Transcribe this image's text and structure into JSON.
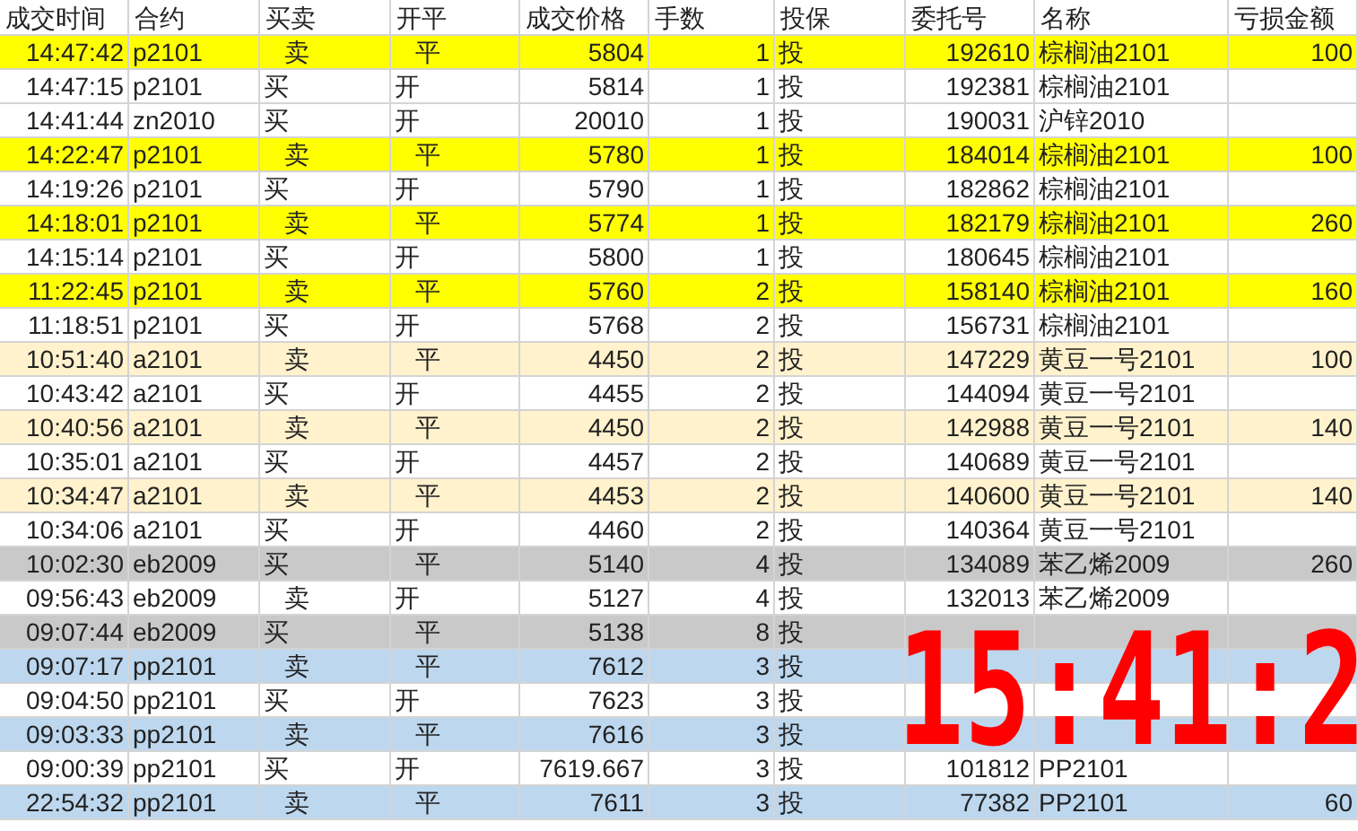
{
  "table": {
    "columns": [
      "成交时间",
      "合约",
      "买卖",
      "开平",
      "成交价格",
      "手数",
      "投保",
      "委托号",
      "名称",
      "亏损金额"
    ],
    "rows": [
      {
        "color": "#ffff00",
        "cells": [
          "14:47:42",
          "p2101",
          "   卖",
          "   平",
          "5804",
          "1",
          "投",
          "192610",
          "棕榈油2101",
          "100"
        ]
      },
      {
        "color": "#ffffff",
        "cells": [
          "14:47:15",
          "p2101",
          "买",
          "开",
          "5814",
          "1",
          "投",
          "192381",
          "棕榈油2101",
          ""
        ]
      },
      {
        "color": "#ffffff",
        "cells": [
          "14:41:44",
          "zn2010",
          "买",
          "开",
          "20010",
          "1",
          "投",
          "190031",
          "沪锌2010",
          ""
        ]
      },
      {
        "color": "#ffff00",
        "cells": [
          "14:22:47",
          "p2101",
          "   卖",
          "   平",
          "5780",
          "1",
          "投",
          "184014",
          "棕榈油2101",
          "100"
        ]
      },
      {
        "color": "#ffffff",
        "cells": [
          "14:19:26",
          "p2101",
          "买",
          "开",
          "5790",
          "1",
          "投",
          "182862",
          "棕榈油2101",
          ""
        ]
      },
      {
        "color": "#ffff00",
        "cells": [
          "14:18:01",
          "p2101",
          "   卖",
          "   平",
          "5774",
          "1",
          "投",
          "182179",
          "棕榈油2101",
          "260"
        ]
      },
      {
        "color": "#ffffff",
        "cells": [
          "14:15:14",
          "p2101",
          "买",
          "开",
          "5800",
          "1",
          "投",
          "180645",
          "棕榈油2101",
          ""
        ]
      },
      {
        "color": "#ffff00",
        "cells": [
          "11:22:45",
          "p2101",
          "   卖",
          "   平",
          "5760",
          "2",
          "投",
          "158140",
          "棕榈油2101",
          "160"
        ]
      },
      {
        "color": "#ffffff",
        "cells": [
          "11:18:51",
          "p2101",
          "买",
          "开",
          "5768",
          "2",
          "投",
          "156731",
          "棕榈油2101",
          ""
        ]
      },
      {
        "color": "#fff2cc",
        "cells": [
          "10:51:40",
          "a2101",
          "   卖",
          "   平",
          "4450",
          "2",
          "投",
          "147229",
          "黄豆一号2101",
          "100"
        ]
      },
      {
        "color": "#ffffff",
        "cells": [
          "10:43:42",
          "a2101",
          "买",
          "开",
          "4455",
          "2",
          "投",
          "144094",
          "黄豆一号2101",
          ""
        ]
      },
      {
        "color": "#fff2cc",
        "cells": [
          "10:40:56",
          "a2101",
          "   卖",
          "   平",
          "4450",
          "2",
          "投",
          "142988",
          "黄豆一号2101",
          "140"
        ]
      },
      {
        "color": "#ffffff",
        "cells": [
          "10:35:01",
          "a2101",
          "买",
          "开",
          "4457",
          "2",
          "投",
          "140689",
          "黄豆一号2101",
          ""
        ]
      },
      {
        "color": "#fff2cc",
        "cells": [
          "10:34:47",
          "a2101",
          "   卖",
          "   平",
          "4453",
          "2",
          "投",
          "140600",
          "黄豆一号2101",
          "140"
        ]
      },
      {
        "color": "#ffffff",
        "cells": [
          "10:34:06",
          "a2101",
          "买",
          "开",
          "4460",
          "2",
          "投",
          "140364",
          "黄豆一号2101",
          ""
        ]
      },
      {
        "color": "#c9c9c9",
        "cells": [
          "10:02:30",
          "eb2009",
          "买",
          "   平",
          "5140",
          "4",
          "投",
          "134089",
          "苯乙烯2009",
          "260"
        ]
      },
      {
        "color": "#ffffff",
        "cells": [
          "09:56:43",
          "eb2009",
          "   卖",
          "开",
          "5127",
          "4",
          "投",
          "132013",
          "苯乙烯2009",
          ""
        ]
      },
      {
        "color": "#c9c9c9",
        "cells": [
          "09:07:44",
          "eb2009",
          "买",
          "   平",
          "5138",
          "8",
          "投",
          "",
          "",
          ""
        ]
      },
      {
        "color": "#bdd7ee",
        "cells": [
          "09:07:17",
          "pp2101",
          "   卖",
          "   平",
          "7612",
          "3",
          "投",
          "",
          "",
          ""
        ]
      },
      {
        "color": "#ffffff",
        "cells": [
          "09:04:50",
          "pp2101",
          "买",
          "开",
          "7623",
          "3",
          "投",
          "",
          "",
          ""
        ]
      },
      {
        "color": "#bdd7ee",
        "cells": [
          "09:03:33",
          "pp2101",
          "   卖",
          "   平",
          "7616",
          "3",
          "投",
          "",
          "",
          ""
        ]
      },
      {
        "color": "#ffffff",
        "cells": [
          "09:00:39",
          "pp2101",
          "买",
          "开",
          "7619.667",
          "3",
          "投",
          "101812",
          "PP2101",
          ""
        ]
      },
      {
        "color": "#bdd7ee",
        "cells": [
          "22:54:32",
          "pp2101",
          "   卖",
          "   平",
          "7611",
          "3",
          "投",
          "77382",
          "PP2101",
          "60"
        ]
      }
    ]
  },
  "clock": {
    "time": "15:41:2"
  }
}
